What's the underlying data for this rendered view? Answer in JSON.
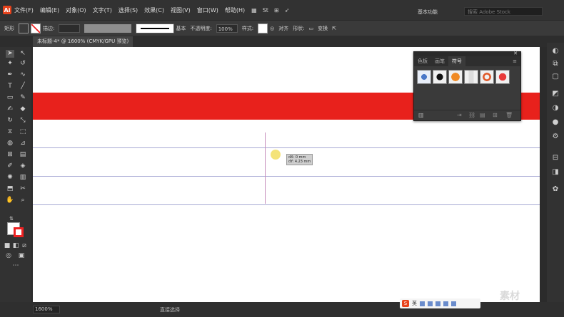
{
  "app": {
    "logo": "Ai"
  },
  "menubar": {
    "items": [
      "文件(F)",
      "编辑(E)",
      "对象(O)",
      "文字(T)",
      "选择(S)",
      "效果(C)",
      "视图(V)",
      "窗口(W)",
      "帮助(H)"
    ],
    "workspace_label": "基本功能",
    "search_placeholder": "搜索 Adobe Stock",
    "bridge_label": "St"
  },
  "controlbar": {
    "object_label": "矩形",
    "stroke_label": "描边:",
    "stroke_profile": "基本",
    "opacity_label": "不透明度:",
    "opacity_value": "100%",
    "style_label": "样式:",
    "align_label": "对齐",
    "shape_label": "形状:",
    "transform_label": "变换"
  },
  "document": {
    "tab_title": "未标题-4* @ 1600% (CMYK/GPU 预览)"
  },
  "symbols_panel": {
    "tabs": [
      "色板",
      "画笔",
      "符号"
    ],
    "active_tab": "符号",
    "symbols": [
      "blue-flower-symbol",
      "black-splat-symbol",
      "orange-button-symbol",
      "paper-symbol",
      "gear-symbol",
      "red-flower-symbol"
    ]
  },
  "canvas": {
    "red_bar_color": "#e8211c",
    "guide_color": "#a7a9d4",
    "tooltip_dx": "dX: 0 mm",
    "tooltip_dy": "dY: 4.23 mm"
  },
  "statusbar": {
    "zoom": "1600%",
    "status_text": "直接选择"
  },
  "ime": {
    "label": "英"
  },
  "watermark": "素材"
}
